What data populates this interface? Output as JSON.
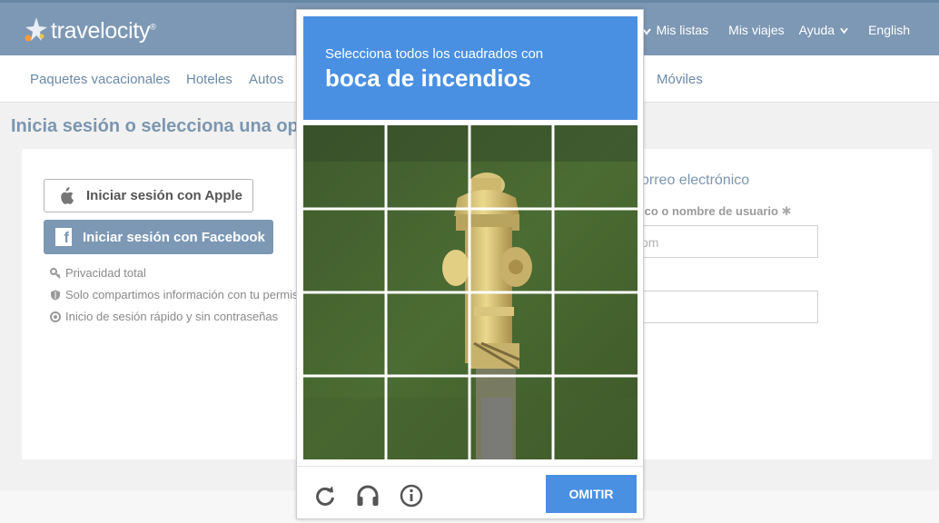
{
  "header": {
    "brand": "travelocity",
    "trademark": "®",
    "nav": [
      "Mis listas",
      "Mis viajes",
      "Ayuda",
      "English"
    ]
  },
  "subnav": [
    "Paquetes vacacionales",
    "Hoteles",
    "Autos",
    "Móviles"
  ],
  "page": {
    "title": "Inicia sesión o selecciona una op"
  },
  "social": {
    "apple_label": "Iniciar sesión con Apple",
    "facebook_label": "Iniciar sesión con Facebook",
    "facebook_glyph": "f",
    "perks": [
      "Privacidad total",
      "Solo compartimos información con tu permiso",
      "Inicio de sesión rápido y sin contraseñas"
    ]
  },
  "email_form": {
    "title": "orreo electrónico",
    "username_label": "ico o nombre de usuario",
    "required_mark": "✱",
    "username_placeholder": "om"
  },
  "captcha": {
    "instruction": "Selecciona todos los cuadrados con",
    "target": "boca de incendios",
    "skip_label": "OMITIR",
    "controls": [
      "reload-icon",
      "headphones-icon",
      "info-icon"
    ]
  },
  "colors": {
    "header_bg": "#7d98b4",
    "captcha_blue": "#4a90e2",
    "link": "#6b89a8"
  }
}
